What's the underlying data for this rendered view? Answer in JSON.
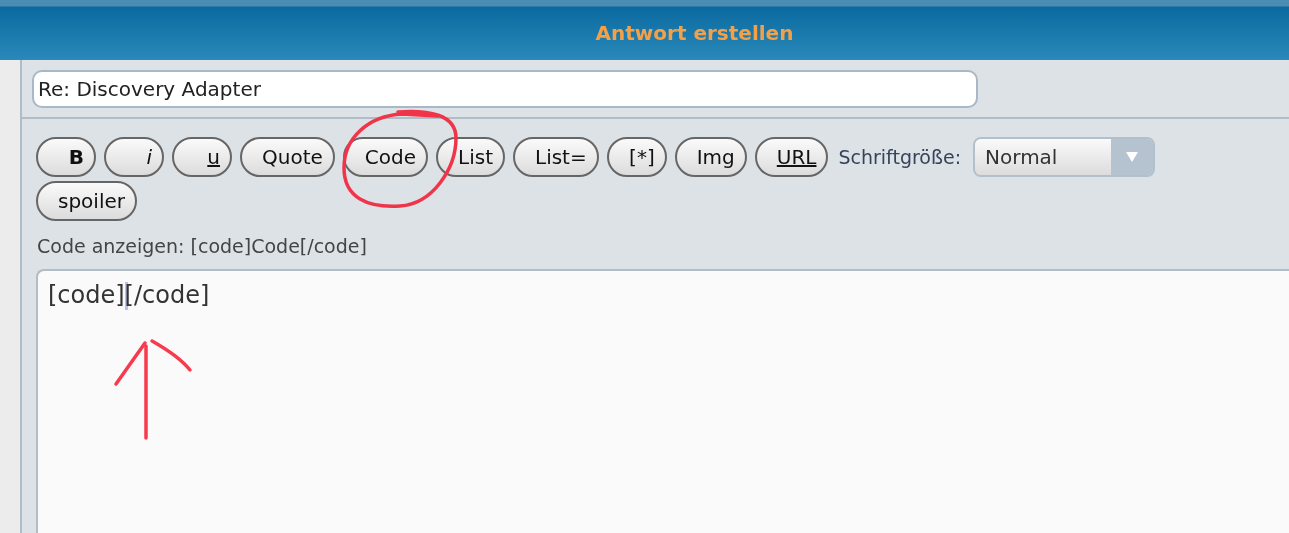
{
  "header": {
    "title": "Antwort erstellen"
  },
  "subject": {
    "value": "Re: Discovery Adapter"
  },
  "toolbar": {
    "buttons": [
      {
        "label": "B",
        "kind": "bold"
      },
      {
        "label": "i",
        "kind": "italic"
      },
      {
        "label": "u",
        "kind": "underline"
      },
      {
        "label": "Quote",
        "kind": "plain"
      },
      {
        "label": "Code",
        "kind": "plain"
      },
      {
        "label": "List",
        "kind": "plain"
      },
      {
        "label": "List=",
        "kind": "plain"
      },
      {
        "label": "[*]",
        "kind": "plain"
      },
      {
        "label": "Img",
        "kind": "plain"
      },
      {
        "label": "URL",
        "kind": "underline"
      },
      {
        "label": "spoiler",
        "kind": "plain"
      }
    ],
    "font_size_label": "Schriftgröße:",
    "font_size": {
      "value": "Normal"
    }
  },
  "help_text": "Code anzeigen: [code]Code[/code]",
  "message": {
    "text_before_caret": "[code]",
    "text_after_caret": "[/code]"
  }
}
